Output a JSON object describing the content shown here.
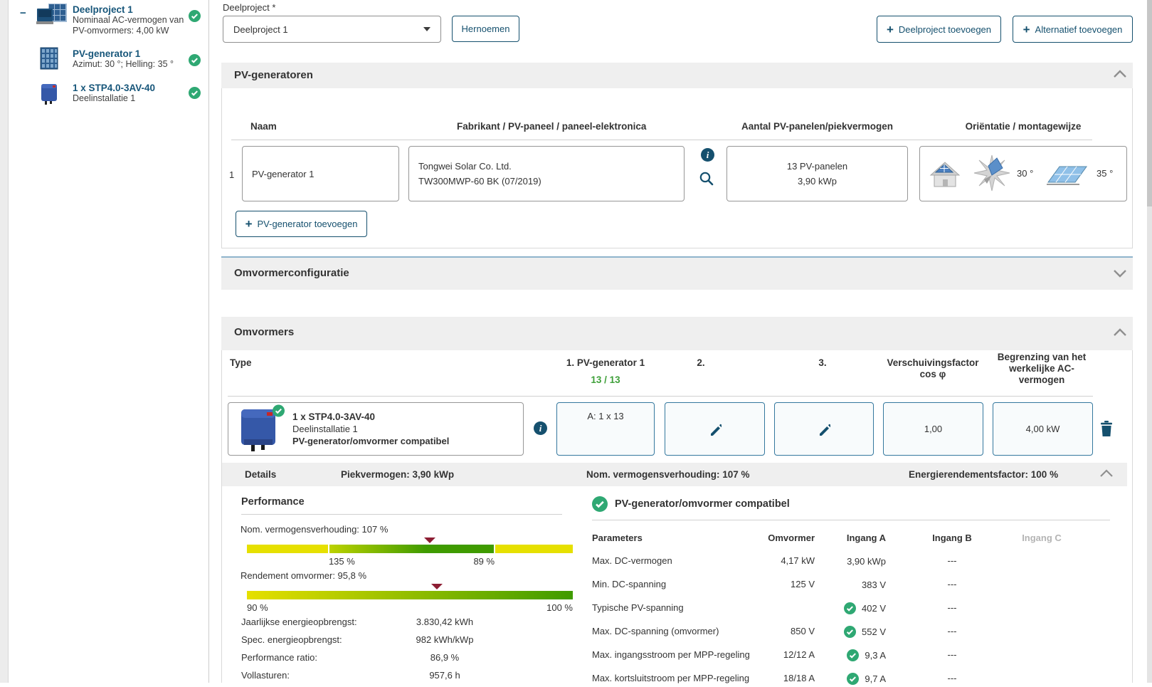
{
  "colors": {
    "accent": "#15506e",
    "link": "#17567a",
    "green_check": "#2fa873",
    "green_text": "#3fa03a",
    "gauge_yellow": "#e6e000",
    "gauge_green": "#3f9b00",
    "gauge_marker": "#8d1d33"
  },
  "sidebar": {
    "items": [
      {
        "toggle": "−",
        "title": "Deelproject 1",
        "subtitle_line1": "Nominaal AC-vermogen van",
        "subtitle_line2": "PV-omvormers: 4,00 kW"
      },
      {
        "title": "PV-generator 1",
        "subtitle_line1": "Azimut: 30 °; Helling: 35 °"
      },
      {
        "title": "1 x STP4.0-3AV-40",
        "subtitle_line1": "Deelinstallatie 1"
      }
    ]
  },
  "toolbar": {
    "label": "Deelproject *",
    "selected": "Deelproject 1",
    "rename": "Hernoemen",
    "add_subproject_plus": "+",
    "add_subproject": "Deelproject toevoegen",
    "add_alternative_plus": "+",
    "add_alternative": "Alternatief toevoegen"
  },
  "pv_generators": {
    "title": "PV-generatoren",
    "col_name": "Naam",
    "col_manufacturer": "Fabrikant / PV-paneel / paneel-elektronica",
    "col_count": "Aantal PV-panelen/piekvermogen",
    "col_orientation": "Oriëntatie / montagewijze",
    "row_index": "1",
    "name_value": "PV-generator 1",
    "manufacturer_line1": "Tongwei Solar Co. Ltd.",
    "manufacturer_line2": "TW300MWP-60 BK (07/2019)",
    "count_line1": "13 PV-panelen",
    "count_line2": "3,90 kWp",
    "azimuth": "30 °",
    "tilt": "35 °",
    "add_plus": "+",
    "add_label": "PV-generator toevoegen"
  },
  "inverter_config": {
    "title": "Omvormerconfiguratie"
  },
  "inverters": {
    "title": "Omvormers",
    "col_type": "Type",
    "col_gen1": "1. PV-generator 1",
    "gen1_count": "13 / 13",
    "col_2": "2.",
    "col_3": "3.",
    "col_cosphi_line1": "Verschuivingsfactor",
    "col_cosphi_line2": "cos φ",
    "col_ac_line1": "Begrenzing van het",
    "col_ac_line2": "werkelijke AC-",
    "col_ac_line3": "vermogen",
    "row": {
      "title": "1 x STP4.0-3AV-40",
      "subtitle": "Deelinstallatie 1",
      "compat": "PV-generator/omvormer compatibel",
      "gen1_value": "A: 1 x 13",
      "cosphi": "1,00",
      "ac_limit": "4,00 kW"
    },
    "details_bar": {
      "label": "Details",
      "peak": "Piekvermogen: 3,90 kWp",
      "ratio": "Nom. vermogensverhouding: 107 %",
      "energy": "Energierendementsfactor: 100 %"
    }
  },
  "performance": {
    "title": "Performance",
    "gauges": [
      {
        "label": "Nom. vermogensverhouding: 107 %",
        "kind": "band",
        "marker_pct": 56.1,
        "band_start_pct": 25.1,
        "band_end_pct": 76,
        "ticks": [
          {
            "text": "135 %",
            "pct": 25.1,
            "anchor": "left"
          },
          {
            "text": "89 %",
            "pct": 76,
            "anchor": "right"
          }
        ]
      },
      {
        "label": "Rendement omvormer: 95,8 %",
        "kind": "gradient",
        "marker_pct": 58.3,
        "ticks": [
          {
            "text": "90 %",
            "pct": 0,
            "anchor": "left"
          },
          {
            "text": "100 %",
            "pct": 100,
            "anchor": "right"
          }
        ]
      }
    ],
    "metrics": [
      {
        "label": "Jaarlijkse energieopbrengst:",
        "value": "3.830,42 kWh"
      },
      {
        "label": "Spec. energieopbrengst:",
        "value": "982 kWh/kWp"
      },
      {
        "label": "Performance ratio:",
        "value": "86,9 %"
      },
      {
        "label": "Vollasturen:",
        "value": "957,6 h"
      }
    ]
  },
  "compatibility": {
    "title": "PV-generator/omvormer compatibel",
    "col_parameters": "Parameters",
    "col_inverter": "Omvormer",
    "col_a": "Ingang A",
    "col_b": "Ingang B",
    "col_c": "Ingang C",
    "rows": [
      {
        "label": "Max. DC-vermogen",
        "inverter": "4,17 kW",
        "a_check": false,
        "a": "3,90 kWp",
        "b": "---",
        "c": ""
      },
      {
        "label": "Min. DC-spanning",
        "inverter": "125 V",
        "a_check": false,
        "a": "383 V",
        "b": "---",
        "c": ""
      },
      {
        "label": "Typische PV-spanning",
        "inverter": "",
        "a_check": true,
        "a": "402 V",
        "b": "---",
        "c": ""
      },
      {
        "label": "Max. DC-spanning (omvormer)",
        "inverter": "850 V",
        "a_check": true,
        "a": "552 V",
        "b": "---",
        "c": ""
      },
      {
        "label": "Max. ingangsstroom per MPP-regeling",
        "inverter": "12/12 A",
        "a_check": true,
        "a": "9,3 A",
        "b": "---",
        "c": ""
      },
      {
        "label": "Max. kortsluitstroom per MPP-regeling",
        "inverter": "18/18 A",
        "a_check": true,
        "a": "9,7 A",
        "b": "---",
        "c": ""
      }
    ]
  }
}
